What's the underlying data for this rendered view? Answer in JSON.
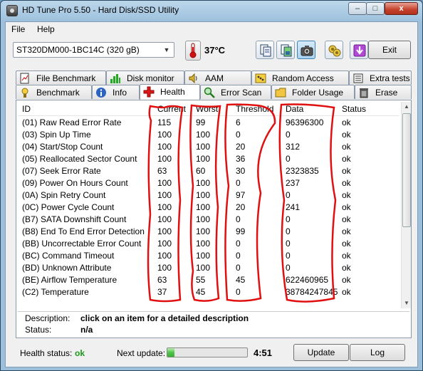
{
  "window": {
    "title": "HD Tune Pro 5.50 - Hard Disk/SSD Utility",
    "minimize_label": "–",
    "maximize_label": "□",
    "close_label": "x"
  },
  "menu": {
    "items": [
      "File",
      "Help"
    ]
  },
  "toolbar": {
    "drive": "ST320DM000-1BC14C (320 gB)",
    "temperature": "37°C",
    "exit_label": "Exit",
    "icons": [
      "copy-text-icon",
      "copy-screenshot-icon",
      "camera-icon",
      "options-icon",
      "save-icon"
    ]
  },
  "tabs": {
    "row1": [
      {
        "label": "File Benchmark",
        "icon": "file-benchmark-icon"
      },
      {
        "label": "Disk monitor",
        "icon": "disk-monitor-icon"
      },
      {
        "label": "AAM",
        "icon": "speaker-icon"
      },
      {
        "label": "Random Access",
        "icon": "random-access-icon"
      },
      {
        "label": "Extra tests",
        "icon": "extra-tests-icon"
      }
    ],
    "row2": [
      {
        "label": "Benchmark",
        "icon": "benchmark-icon"
      },
      {
        "label": "Info",
        "icon": "info-icon"
      },
      {
        "label": "Health",
        "icon": "health-cross-icon"
      },
      {
        "label": "Error Scan",
        "icon": "error-scan-icon"
      },
      {
        "label": "Folder Usage",
        "icon": "folder-icon"
      },
      {
        "label": "Erase",
        "icon": "trash-icon"
      }
    ]
  },
  "table": {
    "columns": [
      "ID",
      "Current",
      "Worst",
      "Threshold",
      "Data",
      "Status"
    ],
    "rows": [
      [
        "(01) Raw Read Error Rate",
        "115",
        "99",
        "6",
        "96396300",
        "ok"
      ],
      [
        "(03) Spin Up Time",
        "100",
        "100",
        "0",
        "0",
        "ok"
      ],
      [
        "(04) Start/Stop Count",
        "100",
        "100",
        "20",
        "312",
        "ok"
      ],
      [
        "(05) Reallocated Sector Count",
        "100",
        "100",
        "36",
        "0",
        "ok"
      ],
      [
        "(07) Seek Error Rate",
        "63",
        "60",
        "30",
        "2323835",
        "ok"
      ],
      [
        "(09) Power On Hours Count",
        "100",
        "100",
        "0",
        "237",
        "ok"
      ],
      [
        "(0A) Spin Retry Count",
        "100",
        "100",
        "97",
        "0",
        "ok"
      ],
      [
        "(0C) Power Cycle Count",
        "100",
        "100",
        "20",
        "241",
        "ok"
      ],
      [
        "(B7) SATA Downshift Count",
        "100",
        "100",
        "0",
        "0",
        "ok"
      ],
      [
        "(B8) End To End Error Detection",
        "100",
        "100",
        "99",
        "0",
        "ok"
      ],
      [
        "(BB) Uncorrectable Error Count",
        "100",
        "100",
        "0",
        "0",
        "ok"
      ],
      [
        "(BC) Command Timeout",
        "100",
        "100",
        "0",
        "0",
        "ok"
      ],
      [
        "(BD) Unknown Attribute",
        "100",
        "100",
        "0",
        "0",
        "ok"
      ],
      [
        "(BE) Airflow Temperature",
        "63",
        "55",
        "45",
        "622460965",
        "ok"
      ],
      [
        "(C2) Temperature",
        "37",
        "45",
        "0",
        "38784247845",
        "ok"
      ]
    ]
  },
  "description": {
    "label": "Description:",
    "value": "click on an item for a detailed description",
    "status_label": "Status:",
    "status_value": "n/a"
  },
  "footer": {
    "health_label": "Health status:",
    "health_value": "ok",
    "next_update_label": "Next update:",
    "next_update_progress": 0.09,
    "countdown": "4:51",
    "update_label": "Update",
    "log_label": "Log"
  },
  "colors": {
    "annotation": "#e01010",
    "ok_green": "#1a9a1a"
  }
}
